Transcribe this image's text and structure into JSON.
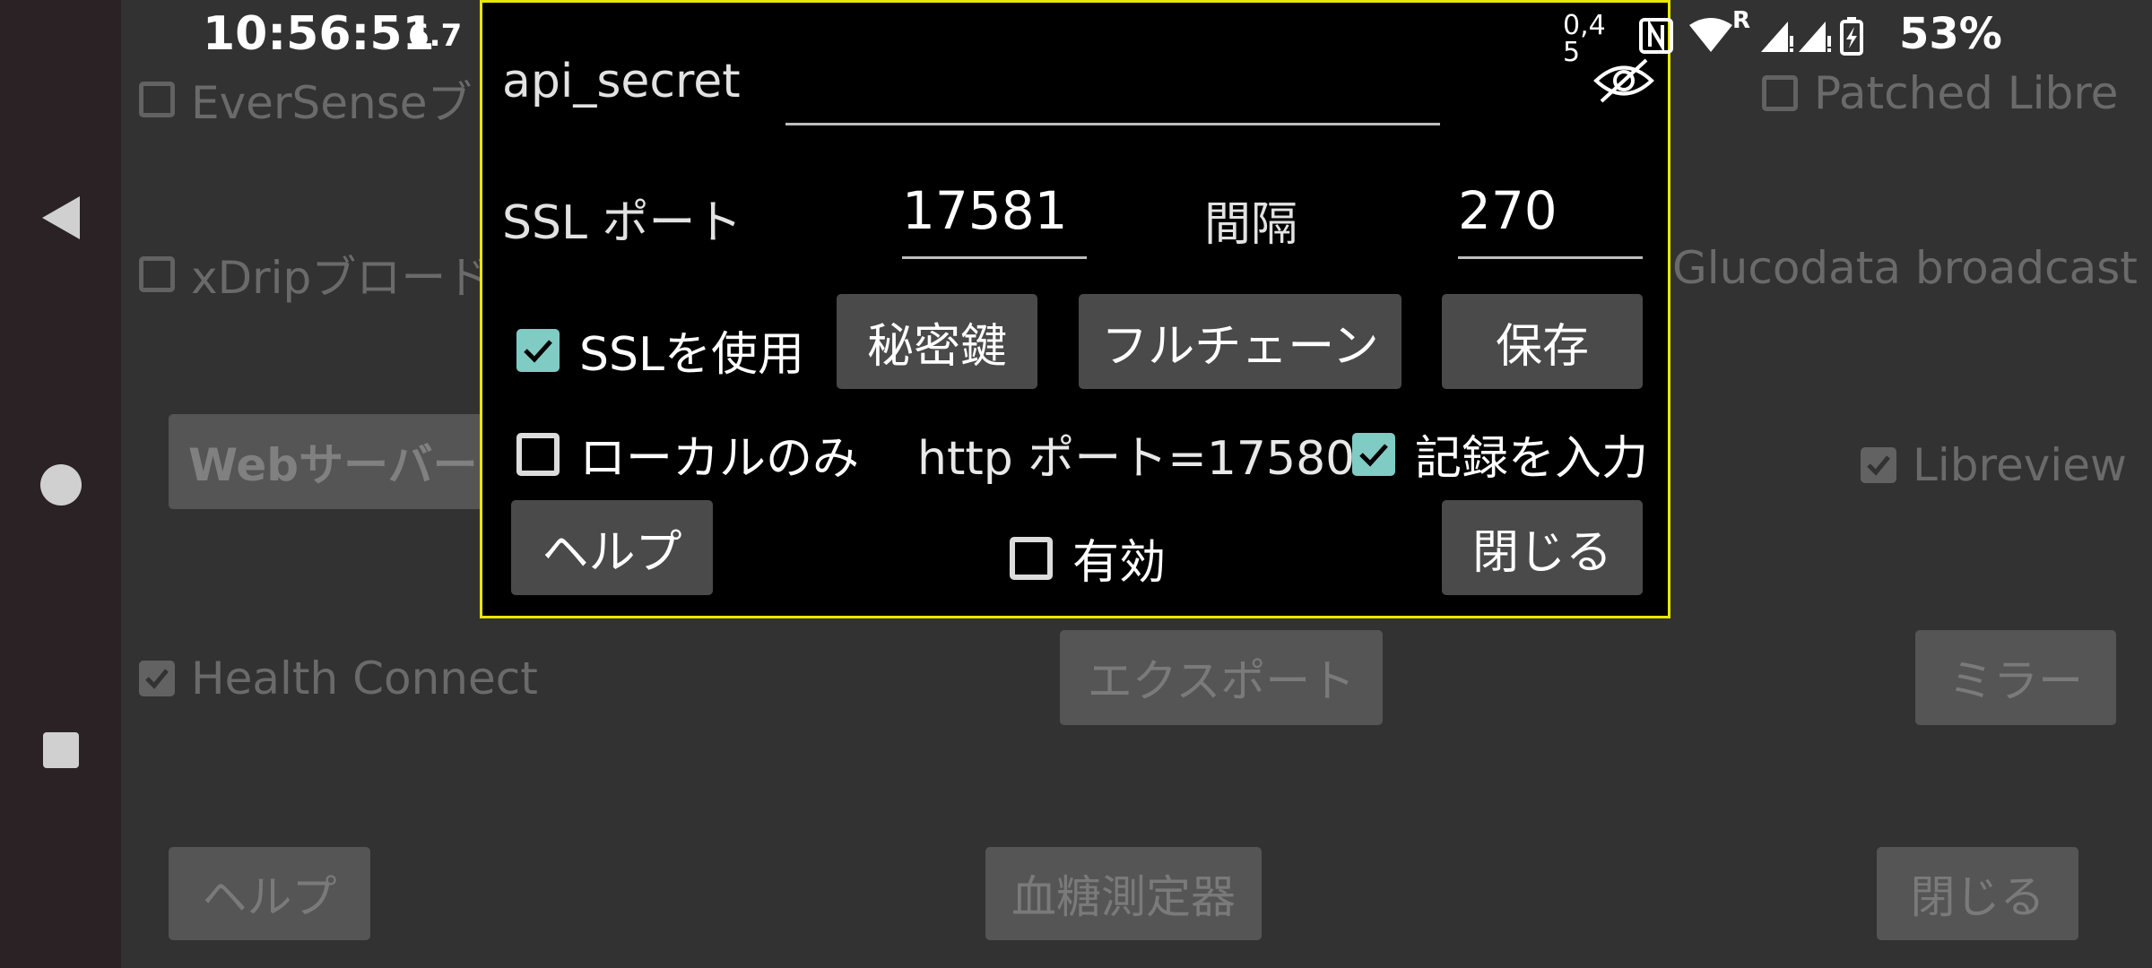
{
  "status_bar": {
    "time": "10:56:51",
    "speed": "6.7",
    "net_speed_line1": "0,4",
    "net_speed_line2": "5",
    "battery": "53%",
    "roaming": "R"
  },
  "nav": {
    "back": "back-icon",
    "home": "home-icon",
    "recents": "recents-icon"
  },
  "background": {
    "eversense": "EverSenseブ",
    "patched_libre": "Patched Libre",
    "xdrip": "xDripブロード",
    "glucodata": "Glucodata broadcast",
    "webserver": "Webサーバー",
    "libreview": "Libreview",
    "health_connect": "Health Connect",
    "export": "エクスポート",
    "mirror": "ミラー",
    "help": "ヘルプ",
    "meter": "血糖測定器",
    "close": "閉じる"
  },
  "dialog": {
    "api_secret_label": "api_secret",
    "api_secret_value": "",
    "ssl_port_label": "SSL ポート",
    "ssl_port_value": "17581",
    "interval_label": "間隔",
    "interval_value": "270",
    "use_ssl_label": "SSLを使用",
    "use_ssl_checked": true,
    "private_key_button": "秘密鍵",
    "full_chain_button": "フルチェーン",
    "save_button": "保存",
    "local_only_label": "ローカルのみ",
    "local_only_checked": false,
    "http_port_text": "http ポート=17580",
    "input_records_label": "記録を入力",
    "input_records_checked": true,
    "help_button": "ヘルプ",
    "enabled_label": "有効",
    "enabled_checked": false,
    "close_button": "閉じる"
  },
  "colors": {
    "accent_check": "#80cbc4",
    "dialog_border": "#e8e800",
    "background": "#323232",
    "nav_bar": "#2b2226"
  }
}
